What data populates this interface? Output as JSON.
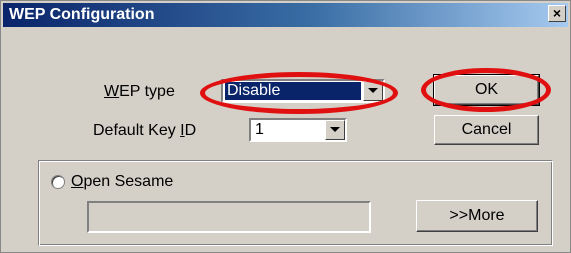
{
  "window": {
    "title": "WEP Configuration",
    "close_glyph": "×"
  },
  "wep_type": {
    "label_prefix": "",
    "label_mnemonic": "W",
    "label_rest": "EP type",
    "value": "Disable"
  },
  "default_key": {
    "label_prefix": "Default Key ",
    "label_mnemonic": "I",
    "label_rest": "D",
    "value": "1"
  },
  "buttons": {
    "ok": "OK",
    "cancel": "Cancel",
    "more": ">>More"
  },
  "open_sesame": {
    "label_mnemonic": "O",
    "label_rest": "pen Sesame",
    "checked": false,
    "text_value": ""
  },
  "annotations": {
    "highlight_color": "#e01010"
  },
  "icons": {
    "dropdown": "chevron-down-icon",
    "close": "close-icon",
    "radio": "radio-icon"
  }
}
